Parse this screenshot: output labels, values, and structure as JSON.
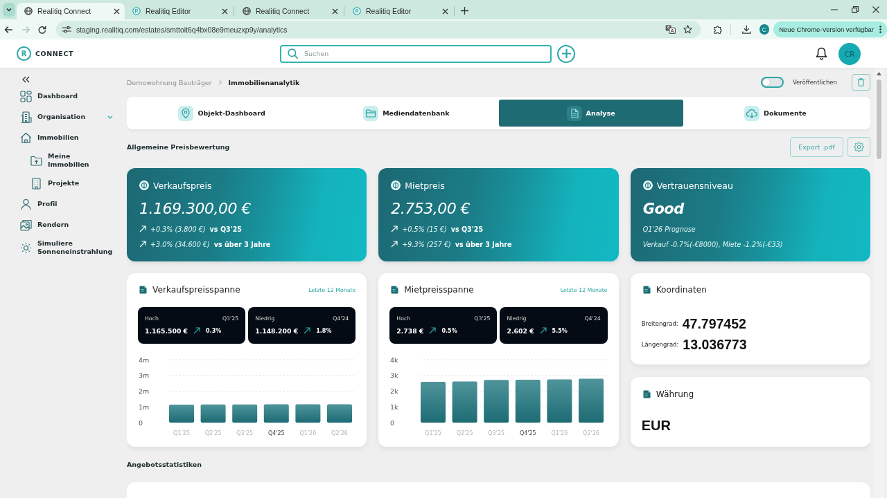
{
  "browser": {
    "tabs": [
      {
        "title": "Realitiq Connect",
        "favicon": false,
        "selected": true
      },
      {
        "title": "Realitiq Editor",
        "favicon": true,
        "selected": false
      },
      {
        "title": "Realitiq Connect",
        "favicon": false,
        "selected": false
      },
      {
        "title": "Realitiq Editor",
        "favicon": true,
        "selected": false
      }
    ],
    "nav_buttons": [
      {
        "kind": "back",
        "disabled": false
      },
      {
        "kind": "forward",
        "disabled": true
      },
      {
        "kind": "reload",
        "disabled": false
      }
    ],
    "url": "staging.realitiq.com/estates/smttoit6q4bx08e9meuzxp9y/analytics",
    "profile_initial": "C",
    "update_button": "Neue Chrome-Version verfügbar"
  },
  "header": {
    "logo_mark": "R",
    "logo_text": "CONNECT",
    "search": {
      "placeholder": "Suchen"
    },
    "avatar": "CR"
  },
  "sidebar": {
    "items": [
      {
        "label": "Dashboard",
        "expandable": false
      },
      {
        "label": "Organisation",
        "expandable": true
      },
      {
        "label": "Immobilien",
        "expandable": false,
        "children": [
          {
            "label": "Meine Immobilien"
          },
          {
            "label": "Projekte"
          }
        ]
      },
      {
        "label": "Profil",
        "expandable": false
      },
      {
        "label": "Rendern",
        "expandable": false
      },
      {
        "label": "Simuliere Sonneneinstrahlung",
        "expandable": false
      }
    ]
  },
  "breadcrumb": [
    "Demowohnung Bauträger",
    "Immobilienanalytik"
  ],
  "publish": {
    "label": "Veröffentlichen",
    "on": false
  },
  "nav_tabs": [
    {
      "label": "Objekt-Dashboard",
      "selected": false
    },
    {
      "label": "Mediendatenbank",
      "selected": false
    },
    {
      "label": "Analyse",
      "selected": true
    },
    {
      "label": "Dokumente",
      "selected": false
    }
  ],
  "price_section": {
    "title": "Allgemeine Preisbewertung",
    "export_button": "Export .pdf"
  },
  "price_cards": [
    {
      "kind": "price",
      "title": "Verkaufspreis",
      "value": "1.169.300,00 €",
      "changes": [
        {
          "delta": "+0.3% (3.800 €)",
          "comparison": "vs Q3'25"
        },
        {
          "delta": "+3.0% (34.600 €)",
          "comparison": "vs über 3 Jahre"
        }
      ]
    },
    {
      "kind": "price",
      "title": "Mietpreis",
      "value": "2.753,00 €",
      "changes": [
        {
          "delta": "+0.5% (15 €)",
          "comparison": "vs Q3'25"
        },
        {
          "delta": "+9.3% (257 €)",
          "comparison": "vs über 3 Jahre"
        }
      ]
    },
    {
      "kind": "forecast",
      "title": "Vertrauensniveau",
      "value": "Good",
      "subtitle": "Q1'26 Prognose",
      "detail": "Verkauf -0.7%(-€8000), Miete -1.2%(-€33)"
    }
  ],
  "range_cards": [
    {
      "title": "Verkaufspreisspanne",
      "period": "Letzte 12 Monate",
      "stats": [
        {
          "label": "Hoch",
          "quarter": "Q3'25",
          "value": "1.165.500 €",
          "change": "0.3%"
        },
        {
          "label": "Niedrig",
          "quarter": "Q4'24",
          "value": "1.148.200 €",
          "change": "1.8%"
        }
      ],
      "chart_data": {
        "type": "bar",
        "categories": [
          "Q1'25",
          "Q2'25",
          "Q3'25",
          "Q4'25",
          "Q1'26",
          "Q2'26"
        ],
        "values": [
          1140000,
          1150000,
          1150000,
          1160000,
          1160000,
          1170000
        ],
        "ylim": [
          0,
          4000000
        ],
        "yticks": [
          {
            "value": 0,
            "label": "0"
          },
          {
            "value": 1000000,
            "label": "1m"
          },
          {
            "value": 2000000,
            "label": "2m"
          },
          {
            "value": 3000000,
            "label": "3m"
          },
          {
            "value": 4000000,
            "label": "4m"
          }
        ],
        "grid": true,
        "annotations": [
          {
            "x": "Q4'25"
          }
        ]
      }
    },
    {
      "title": "Mietpreisspanne",
      "period": "Letzte 12 Monate",
      "stats": [
        {
          "label": "Hoch",
          "quarter": "Q3'25",
          "value": "2.738 €",
          "change": "0.5%"
        },
        {
          "label": "Niedrig",
          "quarter": "Q4'24",
          "value": "2.602 €",
          "change": "5.5%"
        }
      ],
      "chart_data": {
        "type": "bar",
        "categories": [
          "Q1'25",
          "Q2'25",
          "Q3'25",
          "Q4'25",
          "Q1'26",
          "Q2'26"
        ],
        "values": [
          2590,
          2620,
          2710,
          2720,
          2750,
          2790
        ],
        "ylim": [
          0,
          4000
        ],
        "yticks": [
          {
            "value": 0,
            "label": "0"
          },
          {
            "value": 1000,
            "label": "1k"
          },
          {
            "value": 2000,
            "label": "2k"
          },
          {
            "value": 3000,
            "label": "3k"
          },
          {
            "value": 4000,
            "label": "4k"
          }
        ],
        "grid": true,
        "annotations": [
          {
            "x": "Q4'25"
          }
        ]
      }
    }
  ],
  "coordinates": {
    "title": "Koordinaten",
    "rows": [
      {
        "label": "Breitengrad:",
        "value": "47.797452"
      },
      {
        "label": "Längengrad:",
        "value": "13.036773"
      }
    ]
  },
  "currency": {
    "title": "Währung",
    "value": "EUR"
  },
  "offer_section": {
    "title": "Angebotsstatistiken"
  }
}
